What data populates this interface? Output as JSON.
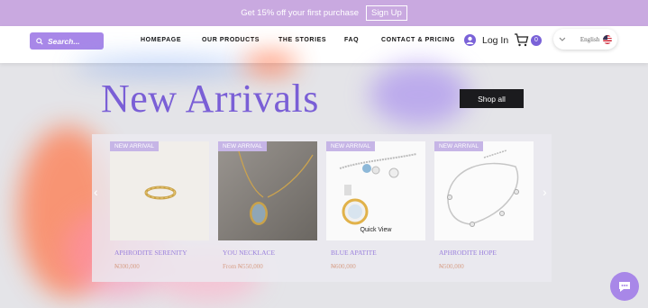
{
  "promo": {
    "text": "Get 15% off your first purchase",
    "button": "Sign Up"
  },
  "header": {
    "search_placeholder": "Search...",
    "nav": [
      "HOMEPAGE",
      "OUR PRODUCTS",
      "THE STORIES",
      "FAQ",
      "CONTACT & PRICING"
    ],
    "login": "Log In",
    "cart_count": "0",
    "language": "English"
  },
  "hero": {
    "title": "New Arrivals",
    "shop_all": "Shop all"
  },
  "products": [
    {
      "badge": "NEW ARRIVAL",
      "name": "APHRODITE SERENITY",
      "price": "₦300,000"
    },
    {
      "badge": "NEW ARRIVAL",
      "name": "YOU NECKLACE",
      "price": "From ₦550,000"
    },
    {
      "badge": "NEW ARRIVAL",
      "name": "BLUE APATITE",
      "price": "₦600,000",
      "quick_view": "Quick View"
    },
    {
      "badge": "NEW ARRIVAL",
      "name": "APHRODITE HOPE",
      "price": "₦500,000"
    }
  ],
  "colors": {
    "accent": "#7a5fd6",
    "promo_bg": "#c9a9e0",
    "search_bg": "#a887e8",
    "price": "#d7a089"
  }
}
